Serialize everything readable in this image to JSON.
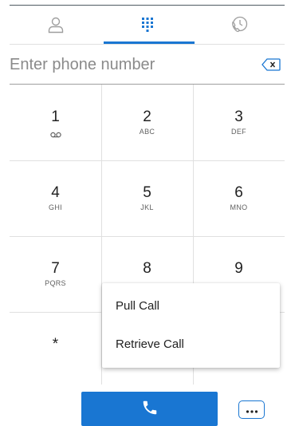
{
  "tabs": [
    {
      "id": "contacts",
      "icon": "person-icon",
      "active": false
    },
    {
      "id": "dialpad",
      "icon": "dialpad-icon",
      "active": true
    },
    {
      "id": "history",
      "icon": "call-history-icon",
      "active": false
    }
  ],
  "dialer": {
    "placeholder": "Enter phone number",
    "value": ""
  },
  "keypad": {
    "keys": [
      {
        "digit": "1",
        "letters": "",
        "icon": "voicemail-icon"
      },
      {
        "digit": "2",
        "letters": "ABC"
      },
      {
        "digit": "3",
        "letters": "DEF"
      },
      {
        "digit": "4",
        "letters": "GHI"
      },
      {
        "digit": "5",
        "letters": "JKL"
      },
      {
        "digit": "6",
        "letters": "MNO"
      },
      {
        "digit": "7",
        "letters": "PQRS"
      },
      {
        "digit": "8",
        "letters": ""
      },
      {
        "digit": "9",
        "letters": ""
      },
      {
        "digit": "*",
        "letters": ""
      }
    ]
  },
  "menu": {
    "items": [
      {
        "label": "Pull Call"
      },
      {
        "label": "Retrieve Call"
      }
    ]
  },
  "colors": {
    "accent": "#1976d2",
    "divider": "#e0e0e0",
    "icon_gray": "#9e9e9e"
  }
}
